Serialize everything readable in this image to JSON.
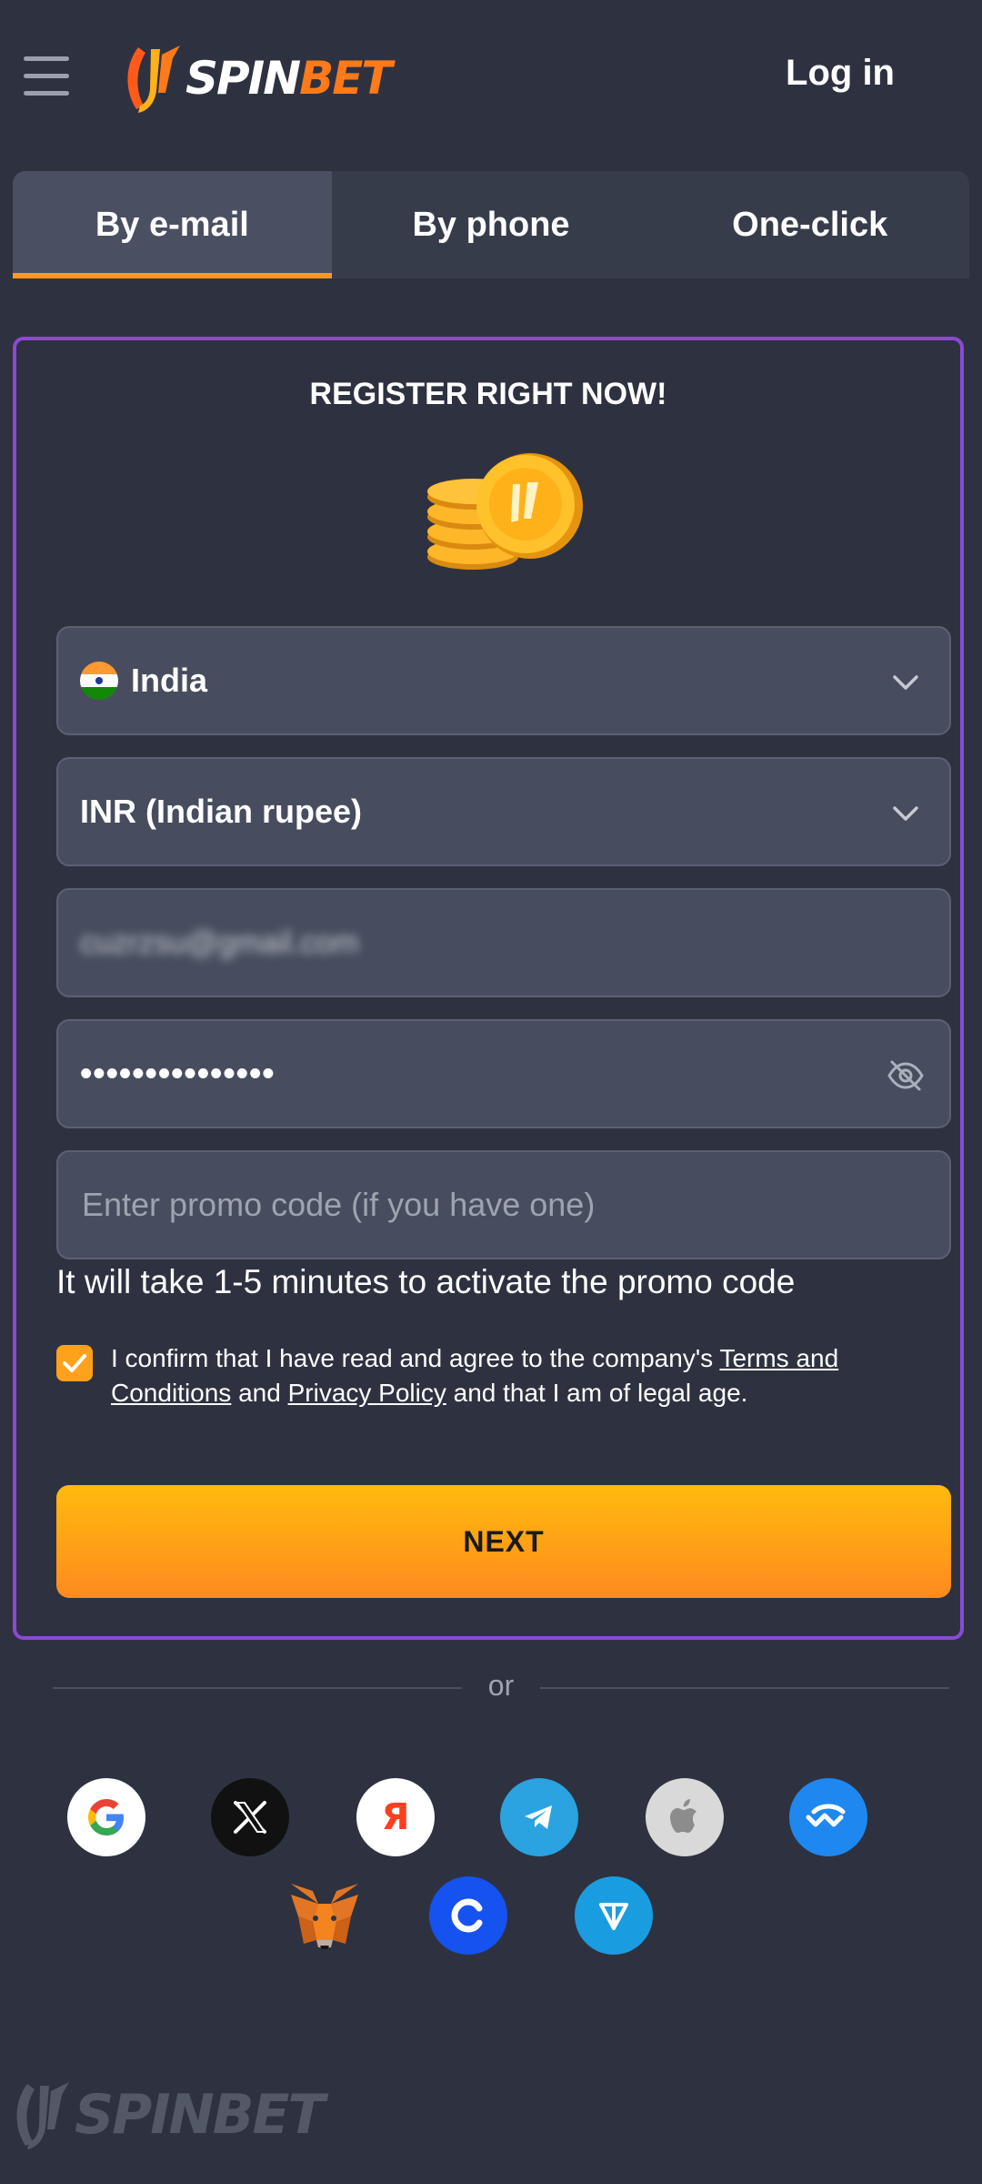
{
  "header": {
    "brand": "SPINBET",
    "brand_bet": "BET",
    "brand_spin": "SPIN",
    "login_label": "Log in"
  },
  "tabs": [
    {
      "label": "By e-mail",
      "active": true
    },
    {
      "label": "By phone",
      "active": false
    },
    {
      "label": "One-click",
      "active": false
    }
  ],
  "form": {
    "title": "REGISTER RIGHT NOW!",
    "country": "India",
    "currency": "INR (Indian rupee)",
    "email_value": "cuzrzsu@gmail.com",
    "password_masked": "•••••••••••••••",
    "promo_placeholder": "Enter promo code (if you have one)",
    "promo_note": "It will take 1-5 minutes to activate the promo code",
    "consent": {
      "checked": true,
      "text_before": "I confirm that I have read and agree to the company's ",
      "terms_link": "Terms and Conditions",
      "text_and": " and ",
      "privacy_link": "Privacy Policy",
      "text_after": " and that I am of legal age."
    },
    "next_label": "NEXT"
  },
  "divider_text": "or",
  "social_logins": [
    {
      "name": "google-icon",
      "bg": "#ffffff"
    },
    {
      "name": "x-icon",
      "bg": "#111111"
    },
    {
      "name": "yandex-icon",
      "bg": "#ffffff"
    },
    {
      "name": "telegram-icon",
      "bg": "#2aa3e0"
    },
    {
      "name": "apple-icon",
      "bg": "#d9d9d9"
    },
    {
      "name": "walletconnect-icon",
      "bg": "#1e88f0"
    },
    {
      "name": "metamask-icon",
      "bg": "transparent"
    },
    {
      "name": "coinbase-icon",
      "bg": "#1652f0"
    },
    {
      "name": "ton-icon",
      "bg": "#1a9de0"
    }
  ],
  "colors": {
    "background": "#2e3240",
    "accent": "#ff9a1a",
    "card_border": "#8b49d6"
  }
}
